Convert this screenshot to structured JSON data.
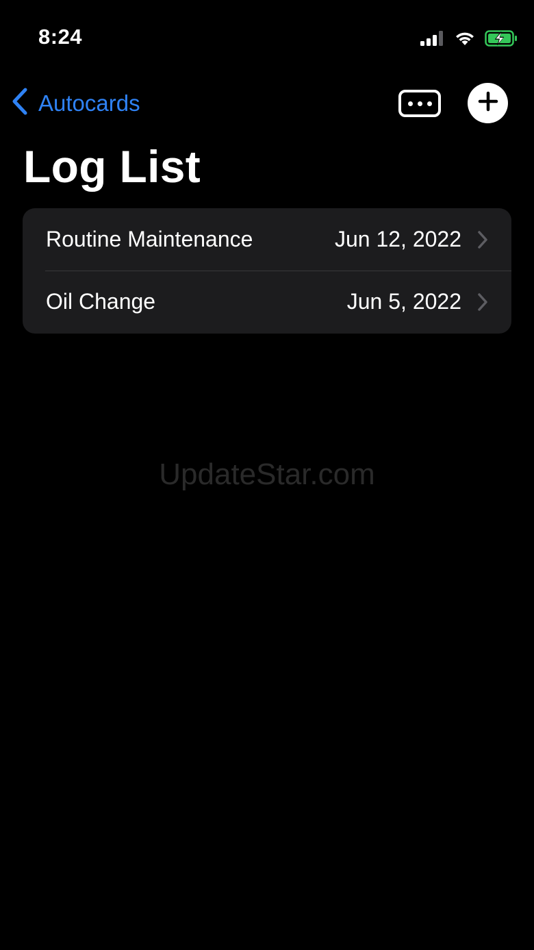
{
  "status_bar": {
    "time": "8:24",
    "icons": [
      "cellular-signal-icon",
      "wifi-icon",
      "battery-charging-icon"
    ]
  },
  "nav": {
    "back_label": "Autocards",
    "more_icon": "ellipsis-icon",
    "add_icon": "plus-icon"
  },
  "page": {
    "title": "Log List"
  },
  "logs": [
    {
      "title": "Routine Maintenance",
      "date": "Jun 12, 2022"
    },
    {
      "title": "Oil Change",
      "date": "Jun 5, 2022"
    }
  ],
  "watermark": "UpdateStar.com",
  "colors": {
    "accent": "#2f82f4",
    "background": "#000000",
    "card": "#1c1c1e",
    "battery": "#34c759"
  }
}
